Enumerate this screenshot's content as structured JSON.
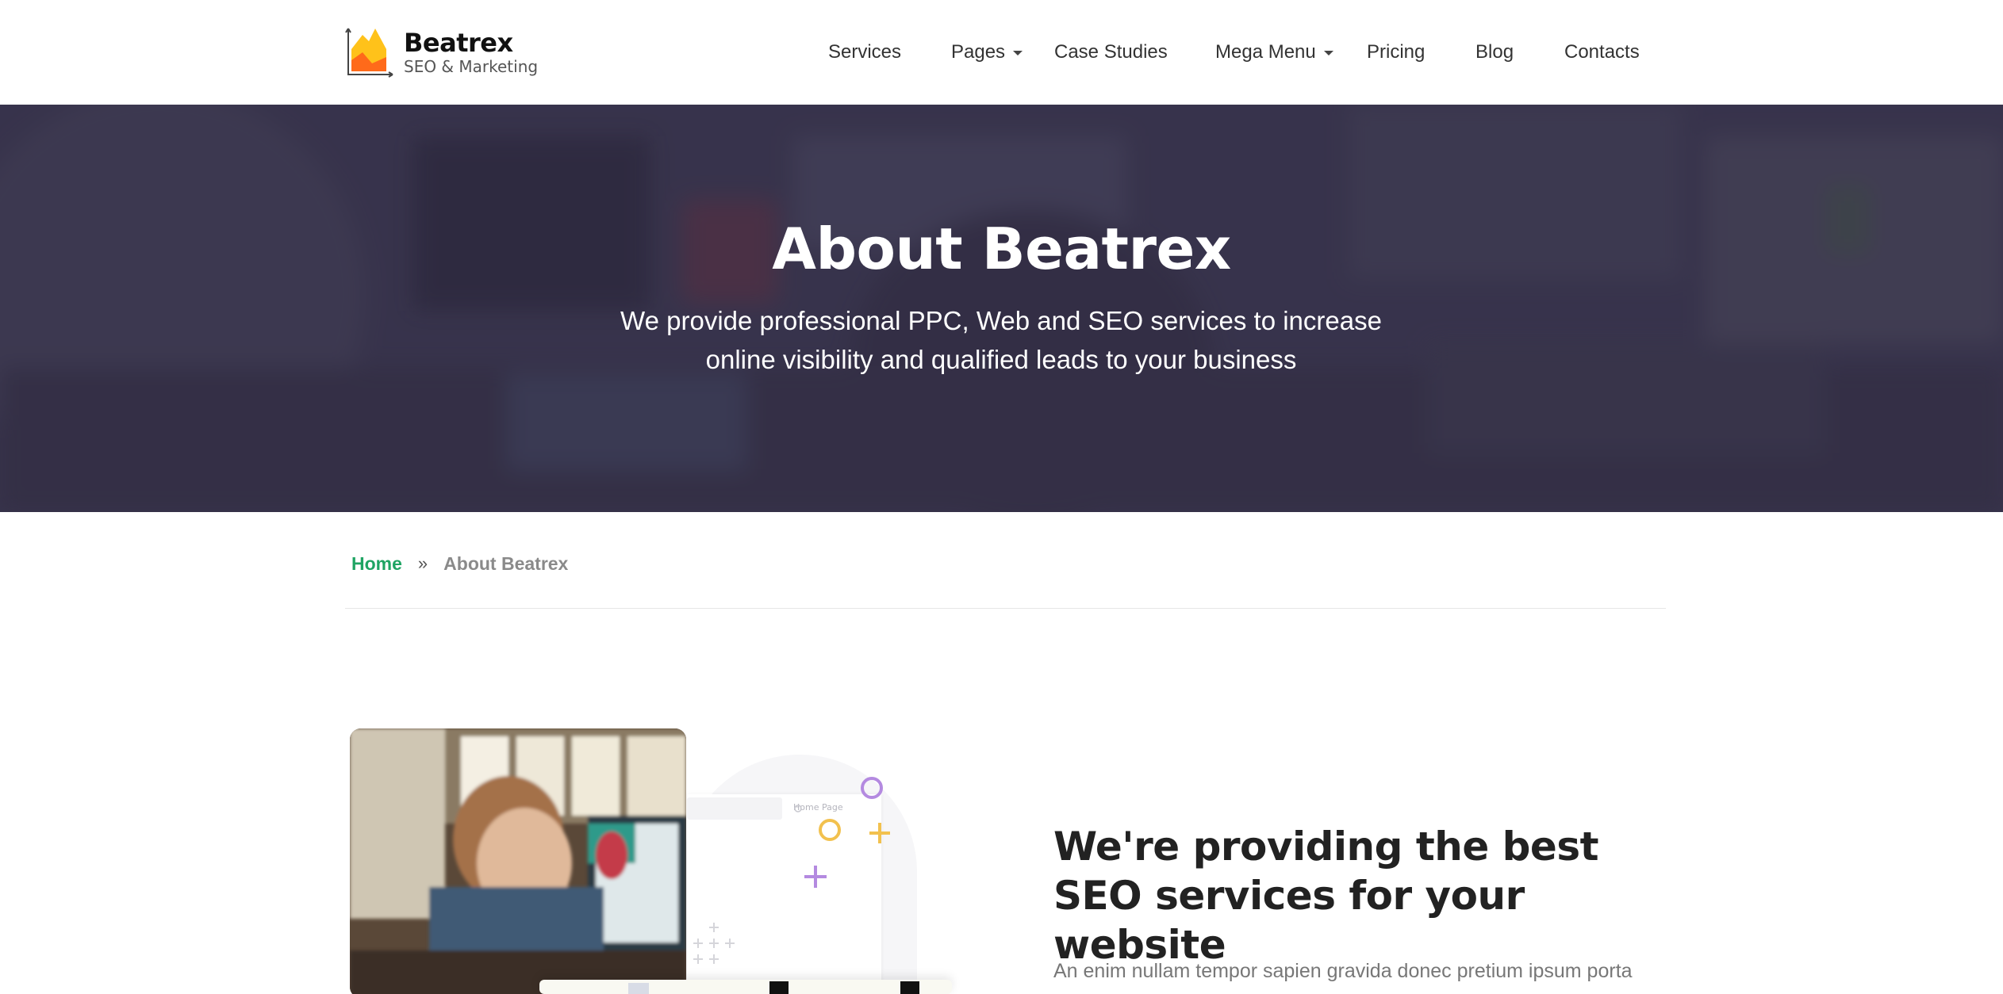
{
  "brand": {
    "name": "Beatrex",
    "tagline": "SEO & Marketing",
    "colors": {
      "accent": "#1fa463",
      "logo_orange": "#ff7a1a",
      "logo_yellow": "#ffc21a"
    }
  },
  "nav": {
    "items": [
      {
        "label": "Services",
        "has_dropdown": false
      },
      {
        "label": "Pages",
        "has_dropdown": true
      },
      {
        "label": "Case Studies",
        "has_dropdown": false
      },
      {
        "label": "Mega Menu",
        "has_dropdown": true
      },
      {
        "label": "Pricing",
        "has_dropdown": false
      },
      {
        "label": "Blog",
        "has_dropdown": false
      },
      {
        "label": "Contacts",
        "has_dropdown": false
      }
    ]
  },
  "hero": {
    "title": "About Beatrex",
    "subtitle": "We provide professional PPC, Web and SEO services to increase online visibility and qualified leads to your business"
  },
  "breadcrumb": {
    "home": "Home",
    "separator": "»",
    "current": "About Beatrex"
  },
  "about": {
    "heading": "We're providing the best SEO services for your website",
    "body": "An enim nullam tempor sapien gravida donec pretium ipsum porta",
    "mockup_label": "Home Page"
  }
}
